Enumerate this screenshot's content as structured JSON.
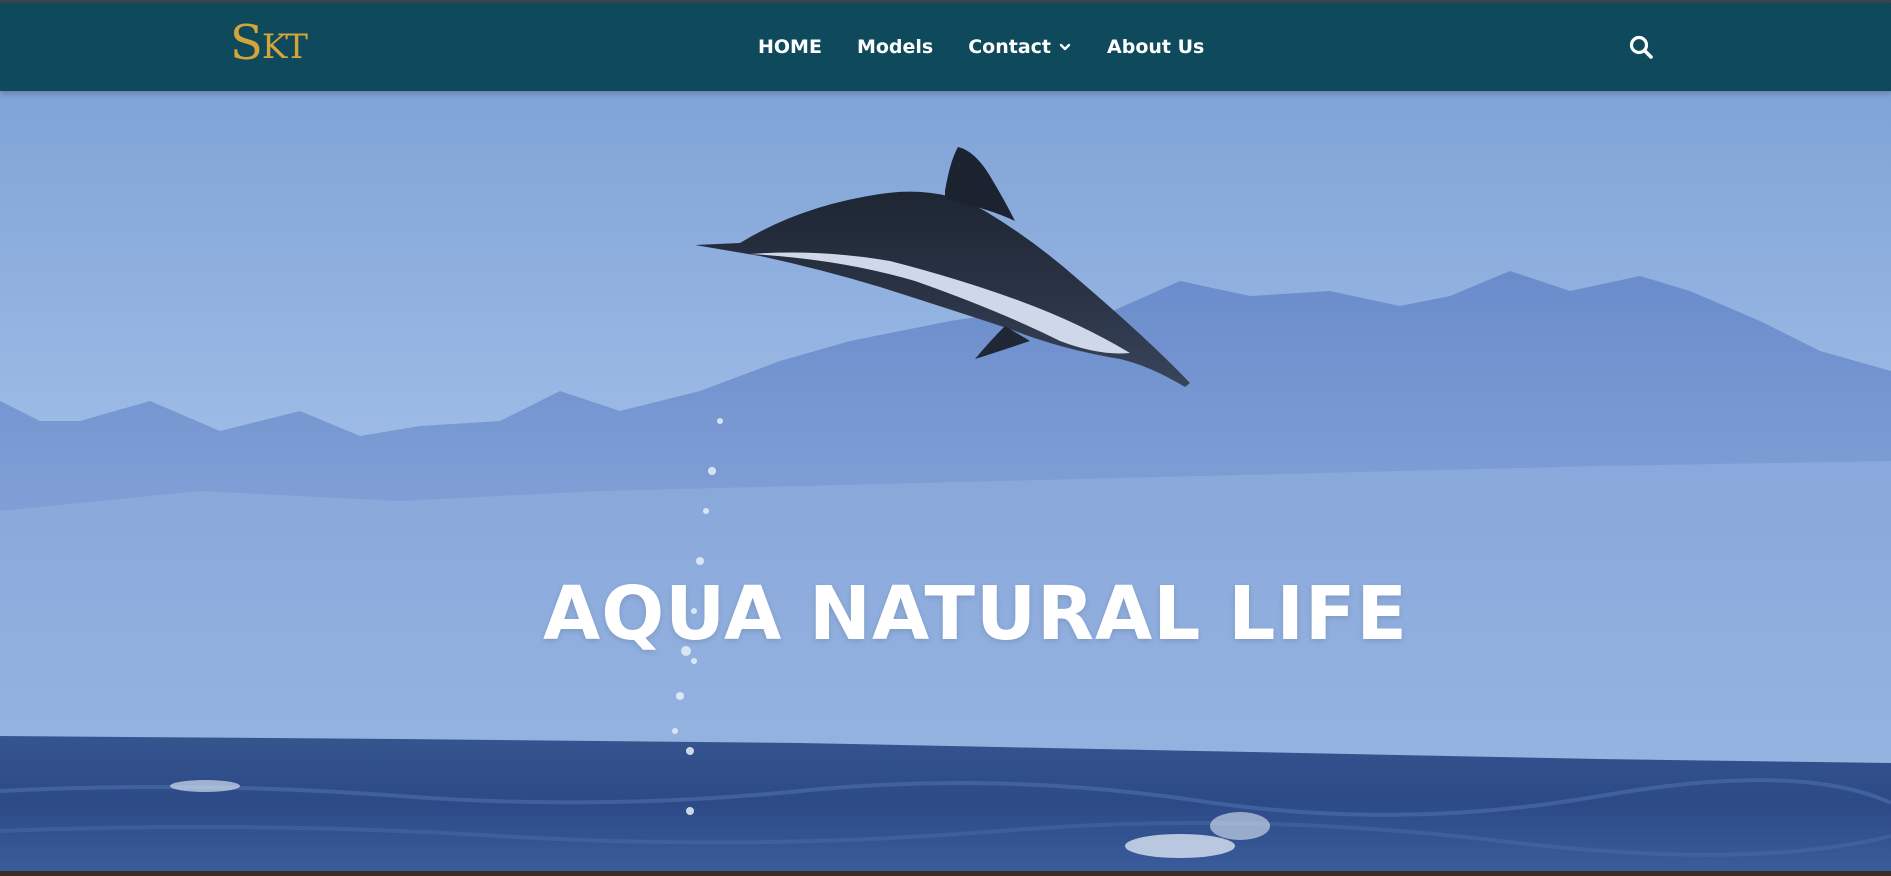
{
  "brand": {
    "logo_text": "SKT",
    "logo_color": "#d4a53a"
  },
  "nav": {
    "items": [
      {
        "label": "HOME"
      },
      {
        "label": "Models"
      },
      {
        "label": "Contact"
      },
      {
        "label": "About Us"
      }
    ],
    "contact_dropdown_icon": "chevron-down-icon",
    "search_icon": "search-icon",
    "background_color": "#0e4a5c"
  },
  "hero": {
    "title": "AQUA NATURAL LIFE",
    "image_subject": "dolphin-leaping-over-sea-with-mountains"
  }
}
